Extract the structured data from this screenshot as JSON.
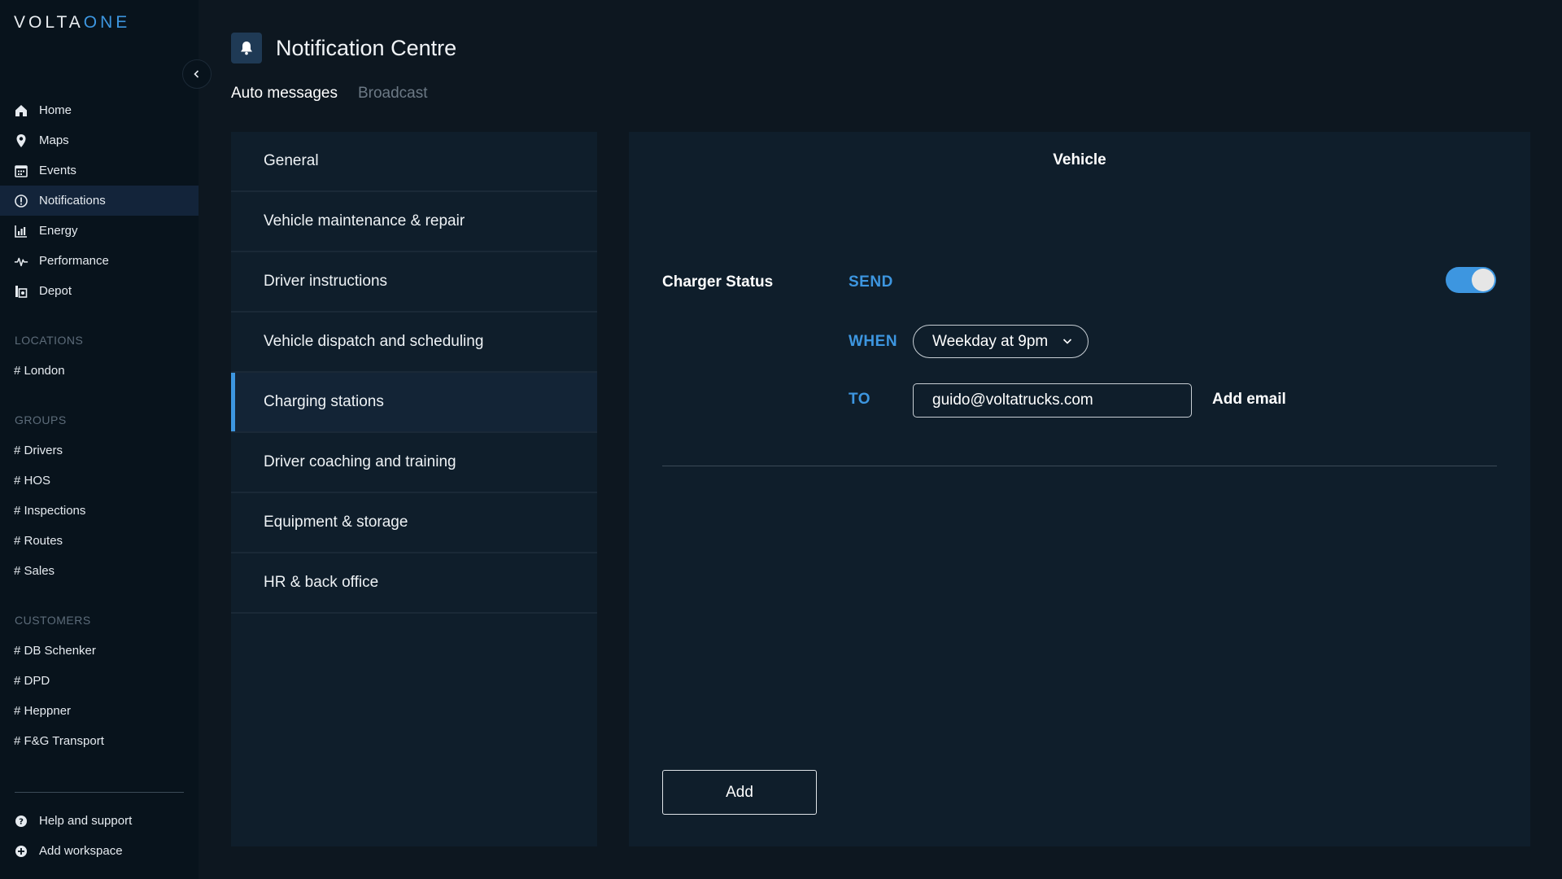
{
  "brand": {
    "logo_main": "VOLTA",
    "logo_accent": "ONE",
    "accent_color": "#3d96e0"
  },
  "sidebar": {
    "nav": [
      {
        "label": "Home",
        "icon": "home-icon"
      },
      {
        "label": "Maps",
        "icon": "map-pin-icon"
      },
      {
        "label": "Events",
        "icon": "calendar-icon"
      },
      {
        "label": "Notifications",
        "icon": "alert-circle-icon",
        "active": true
      },
      {
        "label": "Energy",
        "icon": "bar-chart-icon"
      },
      {
        "label": "Performance",
        "icon": "pulse-icon"
      },
      {
        "label": "Depot",
        "icon": "depot-icon"
      }
    ],
    "locations_title": "LOCATIONS",
    "locations": [
      "# London"
    ],
    "groups_title": "GROUPS",
    "groups": [
      "# Drivers",
      "# HOS",
      "# Inspections",
      "# Routes",
      "# Sales"
    ],
    "customers_title": "CUSTOMERS",
    "customers": [
      "# DB Schenker",
      "# DPD",
      "# Heppner",
      "# F&G Transport"
    ],
    "footer": [
      {
        "label": "Help and support",
        "icon": "help-icon"
      },
      {
        "label": "Add workspace",
        "icon": "add-circle-icon"
      }
    ]
  },
  "header": {
    "title": "Notification Centre",
    "tabs": [
      {
        "label": "Auto messages",
        "active": true
      },
      {
        "label": "Broadcast",
        "active": false
      }
    ]
  },
  "categories": [
    {
      "label": "General"
    },
    {
      "label": "Vehicle maintenance & repair"
    },
    {
      "label": "Driver instructions"
    },
    {
      "label": "Vehicle dispatch and scheduling"
    },
    {
      "label": "Charging stations",
      "active": true
    },
    {
      "label": "Driver coaching and training"
    },
    {
      "label": "Equipment & storage"
    },
    {
      "label": "HR & back office"
    }
  ],
  "detail": {
    "title": "Vehicle",
    "row_label": "Charger Status",
    "send_label": "SEND",
    "send_enabled": true,
    "when_label": "WHEN",
    "when_value": "Weekday at 9pm",
    "to_label": "TO",
    "email_value": "guido@voltatrucks.com",
    "add_email_label": "Add email",
    "add_button_label": "Add"
  }
}
